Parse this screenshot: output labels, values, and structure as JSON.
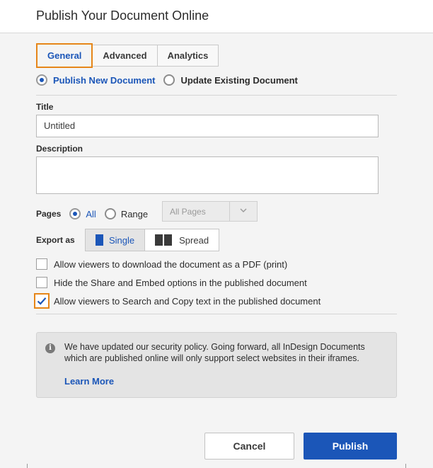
{
  "dialog": {
    "title": "Publish Your Document Online"
  },
  "tabs": [
    {
      "label": "General",
      "active": true
    },
    {
      "label": "Advanced",
      "active": false
    },
    {
      "label": "Analytics",
      "active": false
    }
  ],
  "mode": {
    "publish_new": "Publish New Document",
    "update_existing": "Update Existing Document",
    "selected": "publish_new"
  },
  "title_field": {
    "label": "Title",
    "value": "Untitled"
  },
  "description_field": {
    "label": "Description",
    "value": ""
  },
  "pages": {
    "label": "Pages",
    "all_label": "All",
    "range_label": "Range",
    "selected": "all",
    "dropdown_value": "All Pages"
  },
  "export": {
    "label": "Export as",
    "single_label": "Single",
    "spread_label": "Spread",
    "selected": "single"
  },
  "options": [
    {
      "label": "Allow viewers to download the document as a PDF (print)",
      "checked": false
    },
    {
      "label": "Hide the Share and Embed options in the published document",
      "checked": false
    },
    {
      "label": "Allow viewers to Search and Copy text in the published document",
      "checked": true
    }
  ],
  "notice": {
    "icon": "info-icon",
    "text": "We have updated our security policy. Going forward, all InDesign Documents which are published online will only support select websites in their iframes.",
    "link": "Learn More"
  },
  "buttons": {
    "cancel": "Cancel",
    "publish": "Publish"
  },
  "colors": {
    "accent": "#1b56b8",
    "highlight": "#e68619"
  }
}
